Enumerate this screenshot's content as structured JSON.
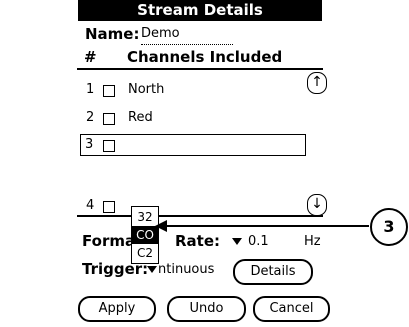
{
  "window": {
    "title": "Stream Details"
  },
  "name": {
    "label": "Name:",
    "value": "Demo"
  },
  "table": {
    "header_num": "#",
    "header_channels": "Channels Included",
    "rows": [
      {
        "num": "1",
        "channel": "North",
        "checked": false
      },
      {
        "num": "2",
        "channel": "Red",
        "checked": false
      },
      {
        "num": "3",
        "channel": "",
        "checked": false
      },
      {
        "num": "4",
        "channel": "",
        "checked": false
      }
    ]
  },
  "format": {
    "label": "Format:",
    "options": [
      "32",
      "CO",
      "C2"
    ],
    "selected": "CO"
  },
  "rate": {
    "label": "Rate:",
    "value": "0.1",
    "unit": "Hz"
  },
  "trigger": {
    "label": "Trigger:",
    "value_visible": "ntinuous"
  },
  "buttons": {
    "details": "Details",
    "apply": "Apply",
    "undo": "Undo",
    "cancel": "Cancel"
  },
  "callout": {
    "number": "3"
  },
  "icons": {
    "scroll_up": "↑",
    "scroll_down": "↓"
  }
}
